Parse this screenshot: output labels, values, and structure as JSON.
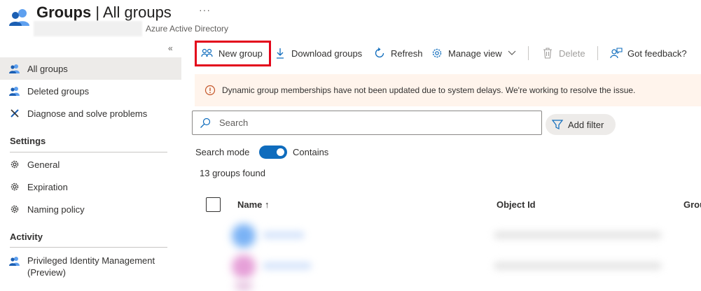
{
  "header": {
    "title_main": "Groups",
    "title_sep": " | ",
    "title_rest": "All groups",
    "subtitle": "Azure Active Directory",
    "ellipsis": "···"
  },
  "sidebar": {
    "collapse": "«",
    "items_top": [
      {
        "label": "All groups",
        "icon": "users-icon",
        "active": true
      },
      {
        "label": "Deleted groups",
        "icon": "users-icon"
      },
      {
        "label": "Diagnose and solve problems",
        "icon": "wrench-icon"
      }
    ],
    "settings_title": "Settings",
    "settings_items": [
      {
        "label": "General",
        "icon": "gear-icon"
      },
      {
        "label": "Expiration",
        "icon": "gear-icon"
      },
      {
        "label": "Naming policy",
        "icon": "gear-icon"
      }
    ],
    "activity_title": "Activity",
    "activity_items": [
      {
        "label_line1": "Privileged Identity Management",
        "label_line2": "(Preview)",
        "icon": "users-icon"
      }
    ]
  },
  "toolbar": {
    "new_group": "New group",
    "download_groups": "Download groups",
    "refresh": "Refresh",
    "manage_view": "Manage view",
    "delete": "Delete",
    "feedback": "Got feedback?"
  },
  "banner": {
    "text": "Dynamic group memberships have not been updated due to system delays. We're working to resolve the issue."
  },
  "search": {
    "placeholder": "Search",
    "add_filter": "Add filter",
    "mode_label": "Search mode",
    "mode_value": "Contains",
    "results_count": "13 groups found"
  },
  "table": {
    "columns": [
      "Name ↑",
      "Object Id",
      "Grou"
    ]
  },
  "colors": {
    "accent": "#0f6cbd",
    "highlight_box": "#e3051b",
    "banner_bg": "#fff4ec",
    "warning": "#c4562a"
  }
}
